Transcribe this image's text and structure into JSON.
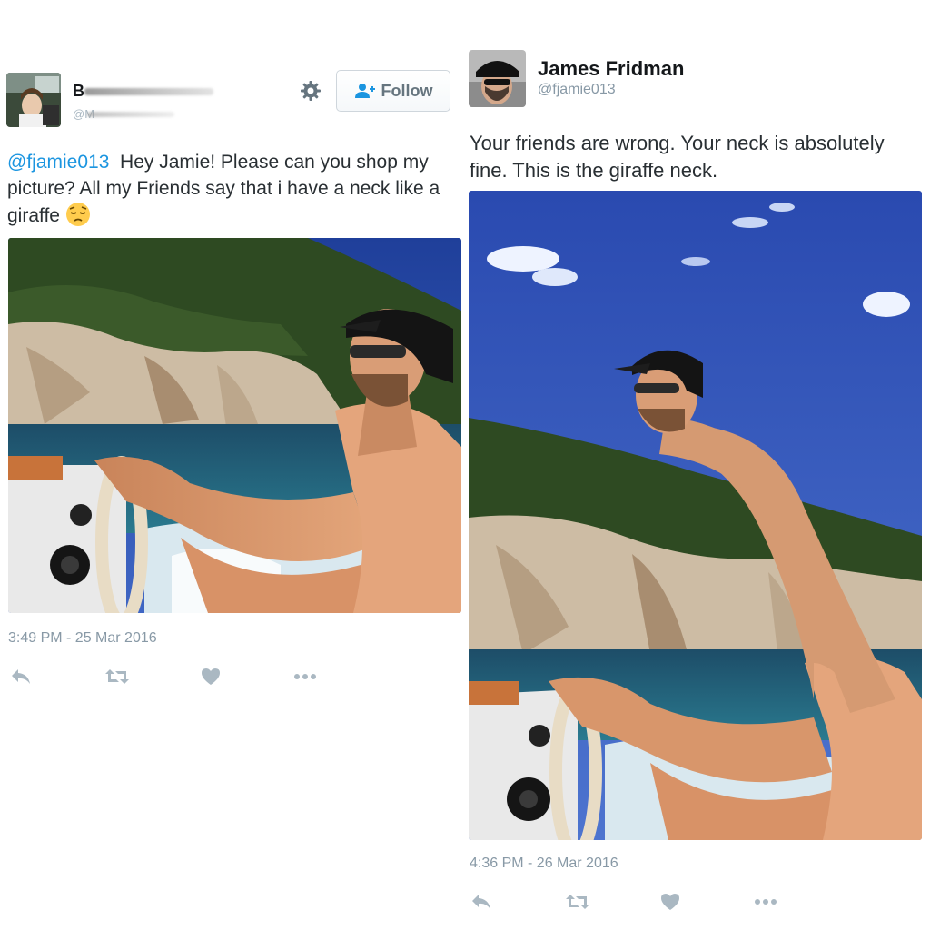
{
  "left_tweet": {
    "display_name_visible": "B",
    "handle_visible": "@M",
    "follow_label": "Follow",
    "text_mention": "@fjamie013",
    "text_body": "Hey Jamie! Please can you shop my picture? All my Friends say that i have a neck like a giraffe",
    "timestamp": "3:49 PM - 25 Mar 2016",
    "icons": [
      "gear-icon",
      "follow-person-icon",
      "pensive-face-emoji",
      "reply-icon",
      "retweet-icon",
      "like-icon",
      "more-icon"
    ]
  },
  "right_tweet": {
    "display_name": "James Fridman",
    "handle": "@fjamie013",
    "text": "Your friends are wrong. Your neck is absolutely fine. This is the giraffe neck.",
    "timestamp": "4:36 PM - 26 Mar 2016",
    "icons": [
      "reply-icon",
      "retweet-icon",
      "like-icon",
      "more-icon"
    ]
  },
  "colors": {
    "link_blue": "#1b95e0",
    "muted_gray": "#8899a6",
    "text_dark": "#292f33",
    "icon_gray": "#aab8c2"
  }
}
